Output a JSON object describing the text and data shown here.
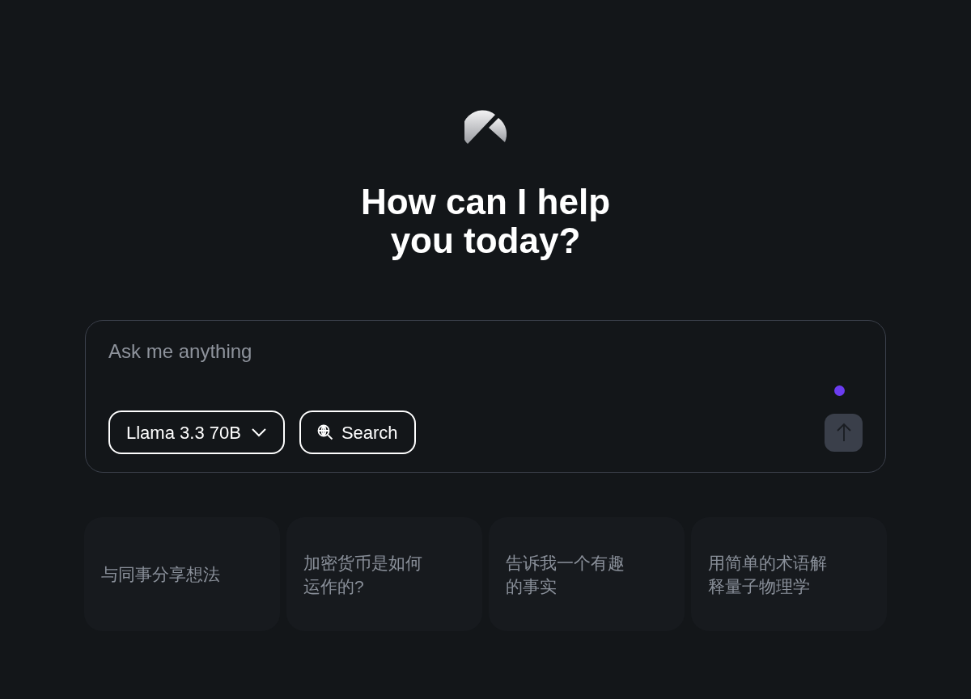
{
  "heading": {
    "lines": [
      "How can I help",
      "you today?"
    ]
  },
  "composer": {
    "placeholder": "Ask me anything",
    "model_button": {
      "label": "Llama 3.3 70B"
    },
    "search_button": {
      "label": "Search"
    },
    "indicator": {
      "color": "#6b3cf0"
    },
    "send_button": {
      "disabled": true
    }
  },
  "suggestions": [
    {
      "text": "与同事分享想法"
    },
    {
      "text": "加密货币是如何运作的?"
    },
    {
      "text": "告诉我一个有趣的事实"
    },
    {
      "text": "用简单的术语解释量子物理学"
    }
  ]
}
